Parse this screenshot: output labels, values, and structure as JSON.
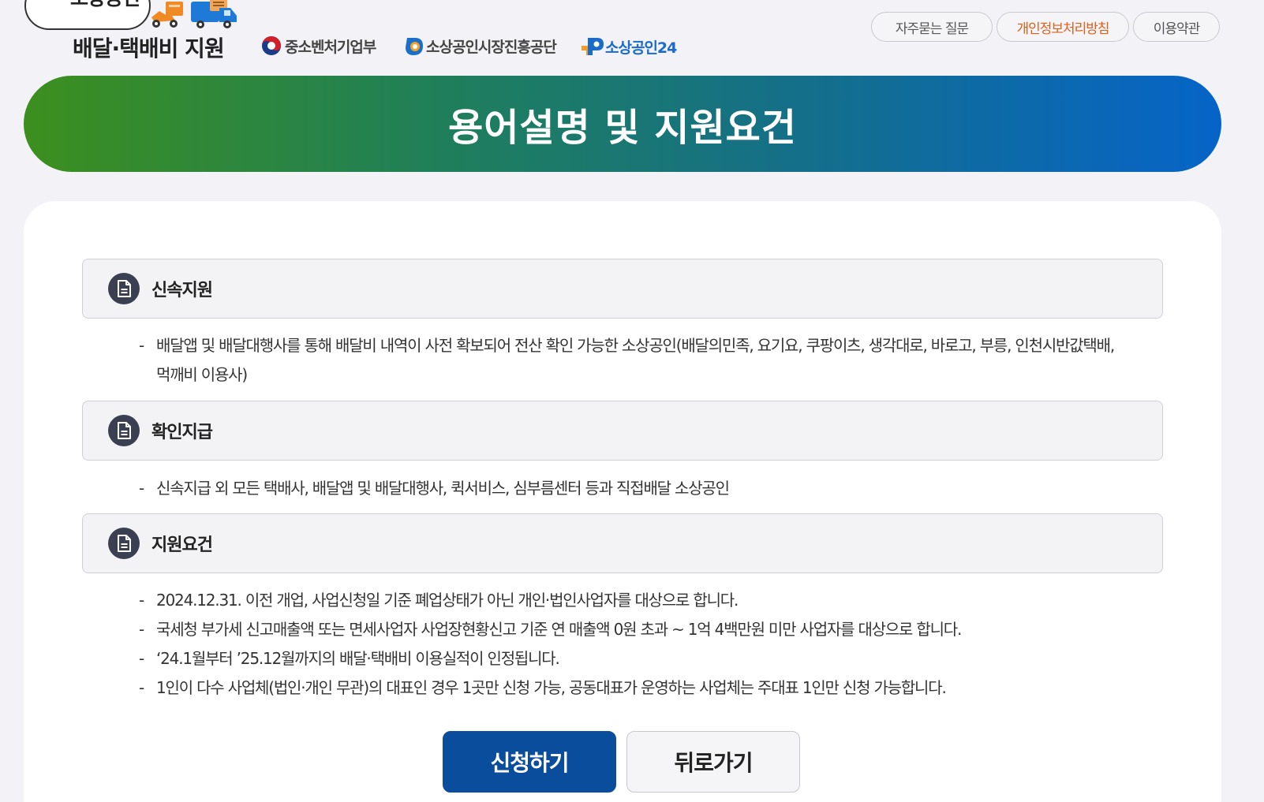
{
  "header": {
    "logo_top": "소상공인",
    "logo_bottom": "배달·택배비 지원",
    "orgs": [
      "중소벤처기업부",
      "소상공인시장진흥공단",
      "소상공인24"
    ],
    "links": {
      "faq": "자주묻는 질문",
      "privacy": "개인정보처리방침",
      "terms": "이용약관"
    },
    "colors": {
      "privacy_link": "#e0601b",
      "brand_blue": "#1b6bc8"
    }
  },
  "banner": {
    "title": "용어설명 및 지원요건",
    "gradient": [
      "#3c8f1e",
      "#0664c8"
    ]
  },
  "sections": [
    {
      "title": "신속지원",
      "icon": "document-icon",
      "items": [
        "배달앱 및 배달대행사를 통해 배달비 내역이 사전 확보되어 전산 확인 가능한 소상공인(배달의민족, 요기요, 쿠팡이츠, 생각대로, 바로고, 부릉, 인천시반값택배, 먹깨비 이용사)"
      ]
    },
    {
      "title": "확인지급",
      "icon": "document-icon",
      "items": [
        "신속지급 외 모든 택배사, 배달앱 및 배달대행사, 퀵서비스, 심부름센터 등과 직접배달 소상공인"
      ]
    },
    {
      "title": "지원요건",
      "icon": "document-icon",
      "items": [
        "2024.12.31. 이전 개업, 사업신청일 기준 폐업상태가 아닌 개인·법인사업자를 대상으로 합니다.",
        "국세청 부가세 신고매출액 또는 면세사업자 사업장현황신고 기준 연 매출액 0원 초과 ~ 1억 4백만원 미만 사업자를 대상으로 합니다.",
        "‘24.1월부터 ’25.12월까지의 배달·택배비 이용실적이 인정됩니다.",
        "1인이 다수 사업체(법인·개인 무관)의 대표인 경우 1곳만 신청 가능, 공동대표가 운영하는 사업체는 주대표 1인만 신청 가능합니다."
      ]
    }
  ],
  "buttons": {
    "apply": "신청하기",
    "back": "뒤로가기",
    "apply_color": "#0a4d9c"
  }
}
